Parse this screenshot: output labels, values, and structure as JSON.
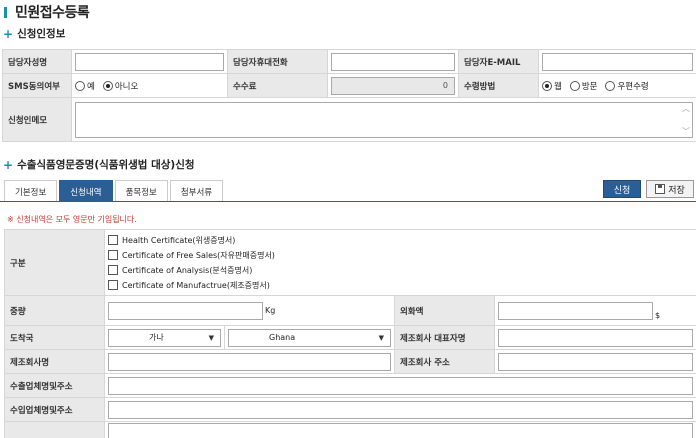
{
  "page": {
    "title": "민원접수등록"
  },
  "applicant": {
    "section_title": "신청인정보",
    "manager_name_label": "담당자성명",
    "manager_phone_label": "담당자휴대전화",
    "manager_email_label": "담당자E-MAIL",
    "sms_label": "SMS동의여부",
    "sms_options": [
      "예",
      "아니오"
    ],
    "sms_selected": "아니오",
    "fee_label": "수수료",
    "fee_value": "0",
    "receive_label": "수령방법",
    "receive_options": [
      "웹",
      "방문",
      "우편수령"
    ],
    "receive_selected": "웹",
    "memo_label": "신청인메모"
  },
  "cert": {
    "section_title": "수출식품영문증명(식품위생법 대상)신청",
    "tabs": [
      "기본정보",
      "신청내역",
      "품목정보",
      "첨부서류"
    ],
    "active_tab": "신청내역",
    "apply_button": "신청",
    "save_button": "저장",
    "notice": "※ 신청내역은 모두 영문만 기입됩니다.",
    "type_label": "구분",
    "type_options": [
      "Health Certificate(위생증명서)",
      "Certificate of Free Sales(자유판매증명서)",
      "Certificate of Analysis(분석증명서)",
      "Certificate of Manufactrue(제조증명서)"
    ],
    "weight_label": "중량",
    "weight_unit": "Kg",
    "amount_label": "외화액",
    "amount_unit": "$",
    "destination_label": "도착국",
    "destination_kr": "가나",
    "destination_en": "Ghana",
    "mfr_rep_label": "제조회사 대표자명",
    "mfr_name_label": "제조회사명",
    "mfr_addr_label": "제조회사 주소",
    "exporter_label": "수출업체명및주소",
    "importer_label": "수입업체명및주소"
  }
}
